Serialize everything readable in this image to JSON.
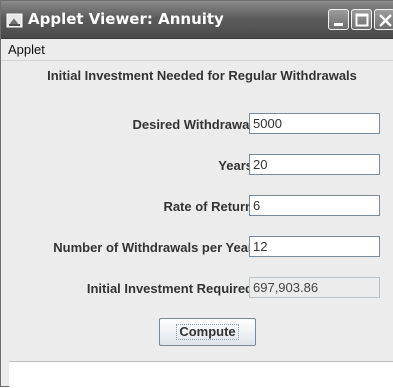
{
  "window": {
    "title": "Applet Viewer: Annuity",
    "icon": "java-applet-icon"
  },
  "titlebar_buttons": [
    {
      "name": "minimize-icon"
    },
    {
      "name": "maximize-icon"
    },
    {
      "name": "close-icon"
    }
  ],
  "menu": {
    "items": [
      "Applet"
    ]
  },
  "form": {
    "heading": "Initial Investment Needed for Regular Withdrawals",
    "desired_withdrawal": {
      "label": "Desired Withdrawal",
      "value": "5000"
    },
    "years": {
      "label": "Years",
      "value": "20"
    },
    "rate_of_return": {
      "label": "Rate of Return",
      "value": "6"
    },
    "withdrawals_per_year": {
      "label": "Number of Withdrawals per Year",
      "value": "12"
    },
    "investment_required": {
      "label": "Initial Investment Required",
      "value": "697,903.86"
    },
    "compute_label": "Compute"
  },
  "colors": {
    "titlebar": "#5d5d5d",
    "panel": "#ececec",
    "text": "#333333"
  }
}
